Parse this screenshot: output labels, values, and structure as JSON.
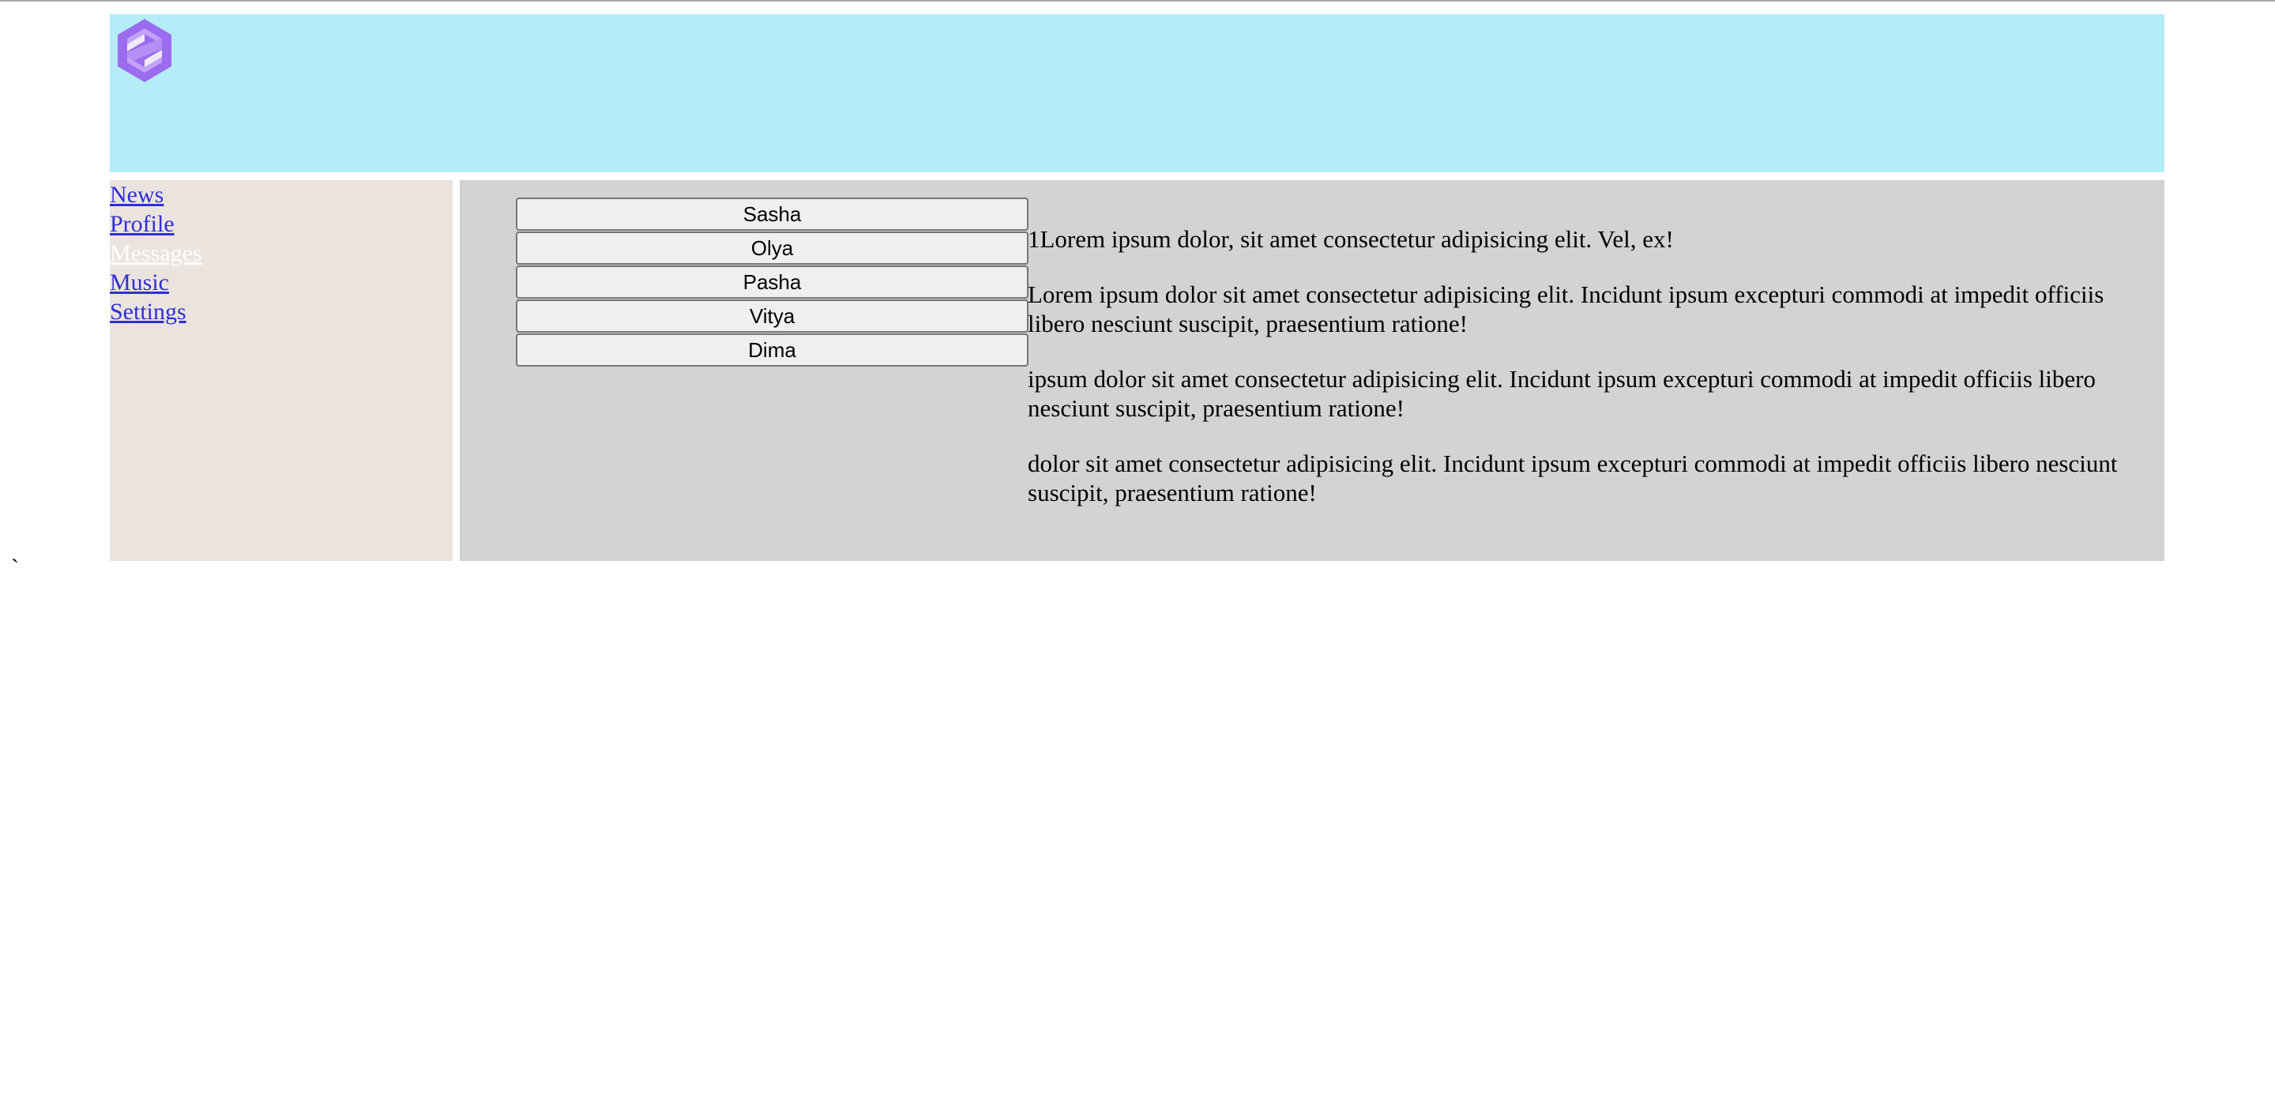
{
  "colors": {
    "header_bg": "#b4ecf8",
    "sidebar_bg": "#ebe4de",
    "content_bg": "#d3d3d3",
    "link": "#2f2fd9",
    "active_link": "#ffffff",
    "logo_accent": "#9b6cf0"
  },
  "header": {
    "logo_icon": "hexagon-logo-icon"
  },
  "nav": {
    "items": [
      {
        "label": "News"
      },
      {
        "label": "Profile"
      },
      {
        "label": "Messages",
        "active": true
      },
      {
        "label": "Music"
      },
      {
        "label": "Settings"
      }
    ]
  },
  "dialogs": {
    "items": [
      {
        "name": "Sasha"
      },
      {
        "name": "Olya"
      },
      {
        "name": "Pasha"
      },
      {
        "name": "Vitya"
      },
      {
        "name": "Dima"
      }
    ]
  },
  "messages": {
    "items": [
      {
        "text": "1Lorem ipsum dolor, sit amet consectetur adipisicing elit. Vel, ex!"
      },
      {
        "text": "Lorem ipsum dolor sit amet consectetur adipisicing elit. Incidunt ipsum excepturi commodi at impedit officiis libero nesciunt suscipit, praesentium ratione!"
      },
      {
        "text": "ipsum dolor sit amet consectetur adipisicing elit. Incidunt ipsum excepturi commodi at impedit officiis libero nesciunt suscipit, praesentium ratione!"
      },
      {
        "text": "dolor sit amet consectetur adipisicing elit. Incidunt ipsum excepturi commodi at impedit officiis libero nesciunt suscipit, praesentium ratione!"
      }
    ]
  },
  "stray_text": "`"
}
